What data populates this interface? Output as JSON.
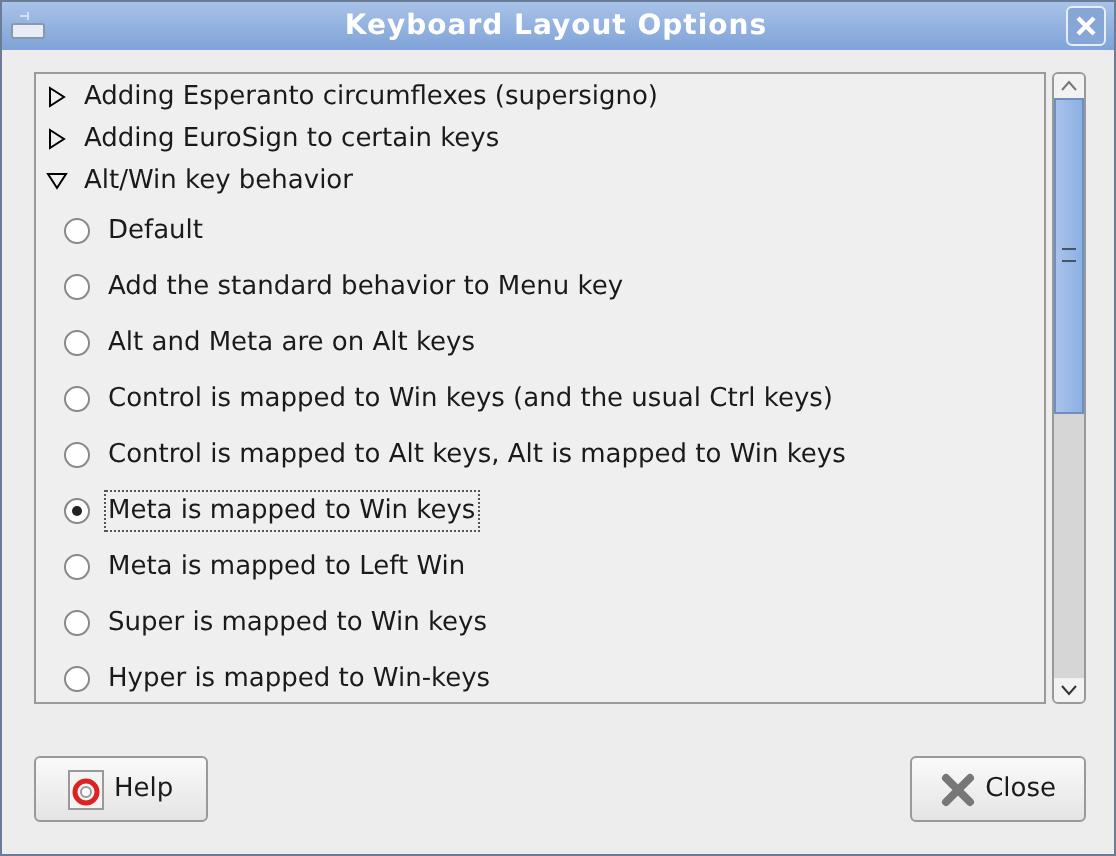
{
  "window": {
    "title": "Keyboard Layout Options"
  },
  "groups": [
    {
      "label": "Adding Esperanto circumflexes (supersigno)",
      "expanded": false
    },
    {
      "label": "Adding EuroSign to certain keys",
      "expanded": false
    },
    {
      "label": "Alt/Win key behavior",
      "expanded": true,
      "options": [
        {
          "label": "Default",
          "selected": false
        },
        {
          "label": "Add the standard behavior to Menu key",
          "selected": false
        },
        {
          "label": "Alt and Meta are on Alt keys",
          "selected": false
        },
        {
          "label": "Control is mapped to Win keys (and the usual Ctrl keys)",
          "selected": false
        },
        {
          "label": "Control is mapped to Alt keys, Alt is mapped to Win keys",
          "selected": false
        },
        {
          "label": "Meta is mapped to Win keys",
          "selected": true
        },
        {
          "label": "Meta is mapped to Left Win",
          "selected": false
        },
        {
          "label": "Super is mapped to Win keys",
          "selected": false
        },
        {
          "label": "Hyper is mapped to Win-keys",
          "selected": false
        }
      ]
    }
  ],
  "buttons": [
    {
      "kind": "help",
      "label": "Help"
    },
    {
      "kind": "close",
      "label": "Close"
    }
  ]
}
